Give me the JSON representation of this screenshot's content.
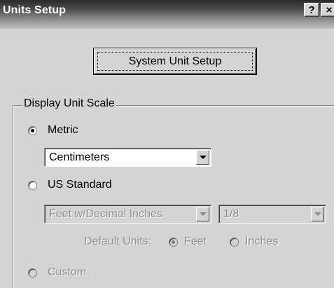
{
  "window": {
    "title": "Units Setup",
    "help_label": "?",
    "close_label": "×"
  },
  "system_unit_setup_label": "System Unit Setup",
  "display_unit_scale": {
    "group_label": "Display Unit Scale",
    "metric": {
      "label": "Metric",
      "checked": true,
      "selected_value": "Centimeters"
    },
    "us_standard": {
      "label": "US Standard",
      "checked": false,
      "unit_value": "Feet w/Decimal Inches",
      "fraction_value": "1/8",
      "default_units_label": "Default Units:",
      "feet_label": "Feet",
      "inches_label": "Inches"
    },
    "custom": {
      "label": "Custom"
    }
  }
}
